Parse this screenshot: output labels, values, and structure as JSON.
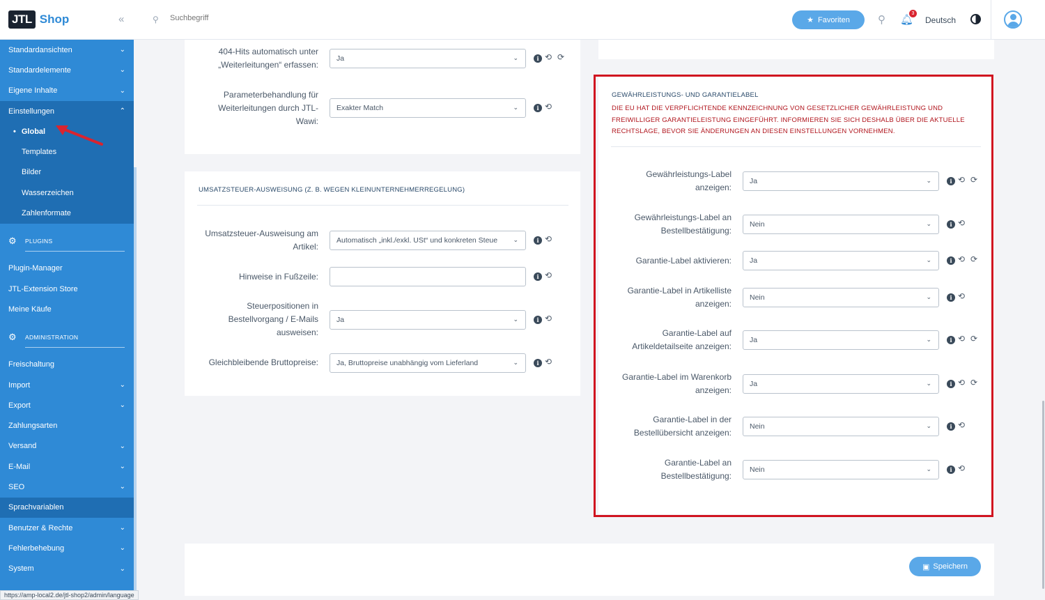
{
  "app": {
    "logo_box": "JTL",
    "logo_text": "Shop",
    "collapse": "«"
  },
  "sidebar": {
    "top_items": [
      {
        "label": "Standardansichten",
        "chev": "⌄"
      },
      {
        "label": "Standardelemente",
        "chev": "⌄"
      },
      {
        "label": "Eigene Inhalte",
        "chev": "⌄"
      }
    ],
    "einstellungen": {
      "label": "Einstellungen",
      "chev": "⌃"
    },
    "sub_items": [
      "Global",
      "Templates",
      "Bilder",
      "Wasserzeichen",
      "Zahlenformate"
    ],
    "plugins_head": "PLUGINS",
    "plugin_items": [
      "Plugin-Manager",
      "JTL-Extension Store",
      "Meine Käufe"
    ],
    "admin_head": "ADMINISTRATION",
    "admin_items": [
      {
        "label": "Freischaltung",
        "chev": ""
      },
      {
        "label": "Import",
        "chev": "⌄"
      },
      {
        "label": "Export",
        "chev": "⌄"
      },
      {
        "label": "Zahlungsarten",
        "chev": ""
      },
      {
        "label": "Versand",
        "chev": "⌄"
      },
      {
        "label": "E-Mail",
        "chev": "⌄"
      },
      {
        "label": "SEO",
        "chev": "⌄"
      },
      {
        "label": "Sprachvariablen",
        "chev": ""
      },
      {
        "label": "Benutzer & Rechte",
        "chev": "⌄"
      },
      {
        "label": "Fehlerbehebung",
        "chev": "⌄"
      },
      {
        "label": "System",
        "chev": "⌄"
      }
    ]
  },
  "topbar": {
    "search_placeholder": "Suchbegriff",
    "favorites_label": "Favoriten",
    "notification_count": "3",
    "language": "Deutsch"
  },
  "redirect_card": {
    "rows": [
      {
        "label": "404-Hits automatisch unter „Weiterleitungen“ erfassen:",
        "value": "Ja",
        "reset": true
      },
      {
        "label": "Parameterbehandlung für Weiterleitungen durch JTL-Wawi:",
        "value": "Exakter Match",
        "reset": false
      }
    ]
  },
  "vat_card": {
    "title": "UMSATZSTEUER-AUSWEISUNG (Z. B. WEGEN KLEINUNTERNEHMERREGELUNG)",
    "rows": [
      {
        "label": "Umsatzsteuer-Ausweisung am Artikel:",
        "value": "Automatisch „inkl./exkl. USt“ und konkreten Steue",
        "type": "select"
      },
      {
        "label": "Hinweise in Fußzeile:",
        "value": "",
        "type": "text"
      },
      {
        "label": "Steuerpositionen in Bestellvorgang / E-Mails ausweisen:",
        "value": "Ja",
        "type": "select"
      },
      {
        "label": "Gleichbleibende Bruttopreise:",
        "value": "Ja, Bruttopreise unabhängig vom Lieferland",
        "type": "select"
      }
    ]
  },
  "warranty_card": {
    "title": "GEWÄHRLEISTUNGS- UND GARANTIELABEL",
    "warning": "DIE EU HAT DIE VERPFLICHTENDE KENNZEICHNUNG VON GESETZLICHER GEWÄHRLEISTUNG UND FREIWILLIGER GARANTIELEISTUNG EINGEFÜHRT. INFORMIEREN SIE SICH DESHALB ÜBER DIE AKTUELLE RECHTSLAGE, BEVOR SIE ÄNDERUNGEN AN DIESEN EINSTELLUNGEN VORNEHMEN.",
    "rows": [
      {
        "label": "Gewährleistungs-Label anzeigen:",
        "value": "Ja",
        "reset": true
      },
      {
        "label": "Gewährleistungs-Label an Bestellbestätigung:",
        "value": "Nein",
        "reset": false
      },
      {
        "label": "Garantie-Label aktivieren:",
        "value": "Ja",
        "reset": true
      },
      {
        "label": "Garantie-Label in Artikelliste anzeigen:",
        "value": "Nein",
        "reset": false
      },
      {
        "label": "Garantie-Label auf Artikeldetailseite anzeigen:",
        "value": "Ja",
        "reset": true
      },
      {
        "label": "Garantie-Label im Warenkorb anzeigen:",
        "value": "Ja",
        "reset": true
      },
      {
        "label": "Garantie-Label in der Bestellübersicht anzeigen:",
        "value": "Nein",
        "reset": false
      },
      {
        "label": "Garantie-Label an Bestellbestätigung:",
        "value": "Nein",
        "reset": false
      }
    ]
  },
  "save_label": "Speichern",
  "status_url": "https://amp-local2.de/jtl-shop2/admin/language",
  "icons": {
    "info": "i",
    "history": "⟲",
    "reset": "⟳",
    "select_arrow": "⌄"
  },
  "colors": {
    "primary": "#2f8ad6",
    "warning": "#b0141c",
    "highlight": "#d01420"
  }
}
